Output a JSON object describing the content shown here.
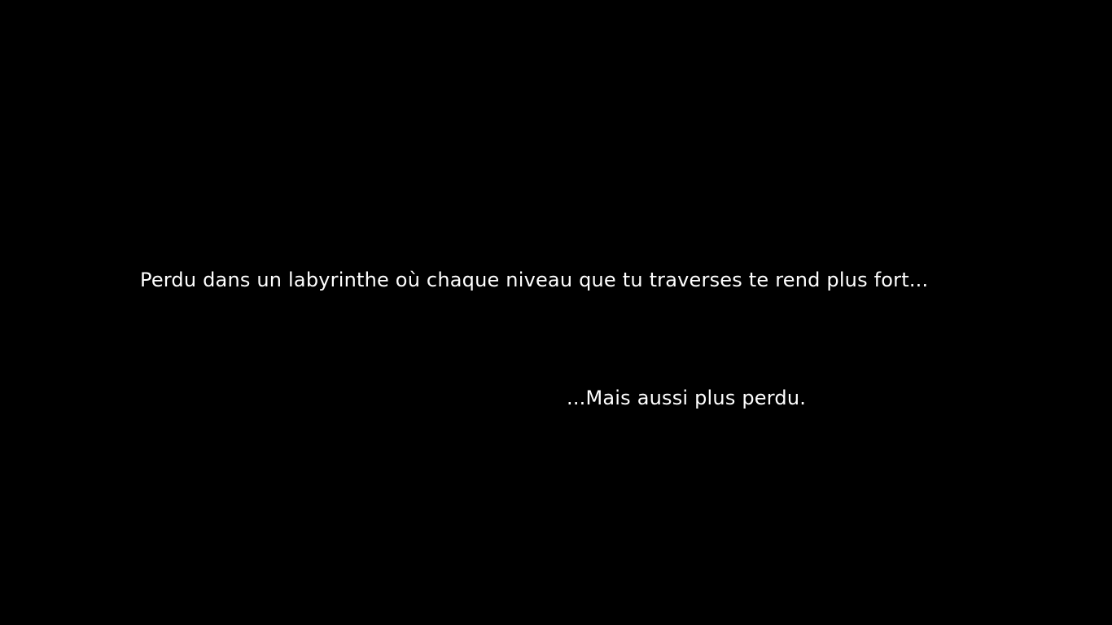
{
  "intro": {
    "line_1": "Perdu dans un labyrinthe où chaque niveau que tu traverses te rend plus fort...",
    "line_2": "...Mais aussi plus perdu."
  },
  "colors": {
    "background": "#000000",
    "text": "#ffffff"
  }
}
